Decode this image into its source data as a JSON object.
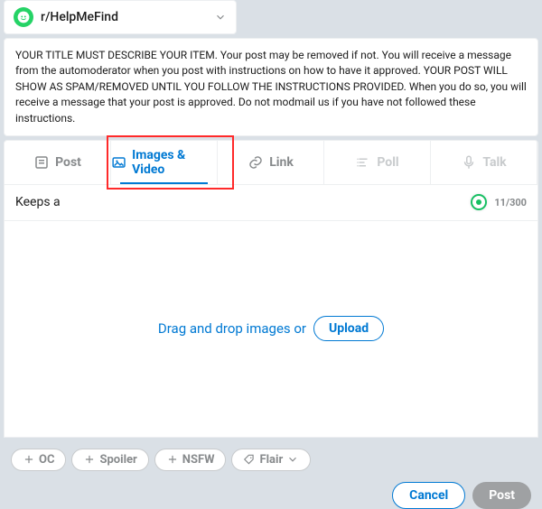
{
  "community": {
    "name": "r/HelpMeFind"
  },
  "notice": "YOUR TITLE MUST DESCRIBE YOUR ITEM. Your post may be removed if not. You will receive a message from the automoderator when you post with instructions on how to have it approved. YOUR POST WILL SHOW AS SPAM/REMOVED UNTIL YOU FOLLOW THE INSTRUCTIONS PROVIDED. When you do so, you will receive a message that your post is approved. Do not modmail us if you have not followed these instructions.",
  "tabs": {
    "post": "Post",
    "images": "Images & Video",
    "link": "Link",
    "poll": "Poll",
    "talk": "Talk",
    "active": "images"
  },
  "title": {
    "value": "Keeps a",
    "counter": "11/300"
  },
  "dropzone": {
    "text": "Drag and drop images or",
    "upload": "Upload"
  },
  "tags": {
    "oc": "OC",
    "spoiler": "Spoiler",
    "nsfw": "NSFW",
    "flair": "Flair"
  },
  "actions": {
    "cancel": "Cancel",
    "post": "Post"
  }
}
